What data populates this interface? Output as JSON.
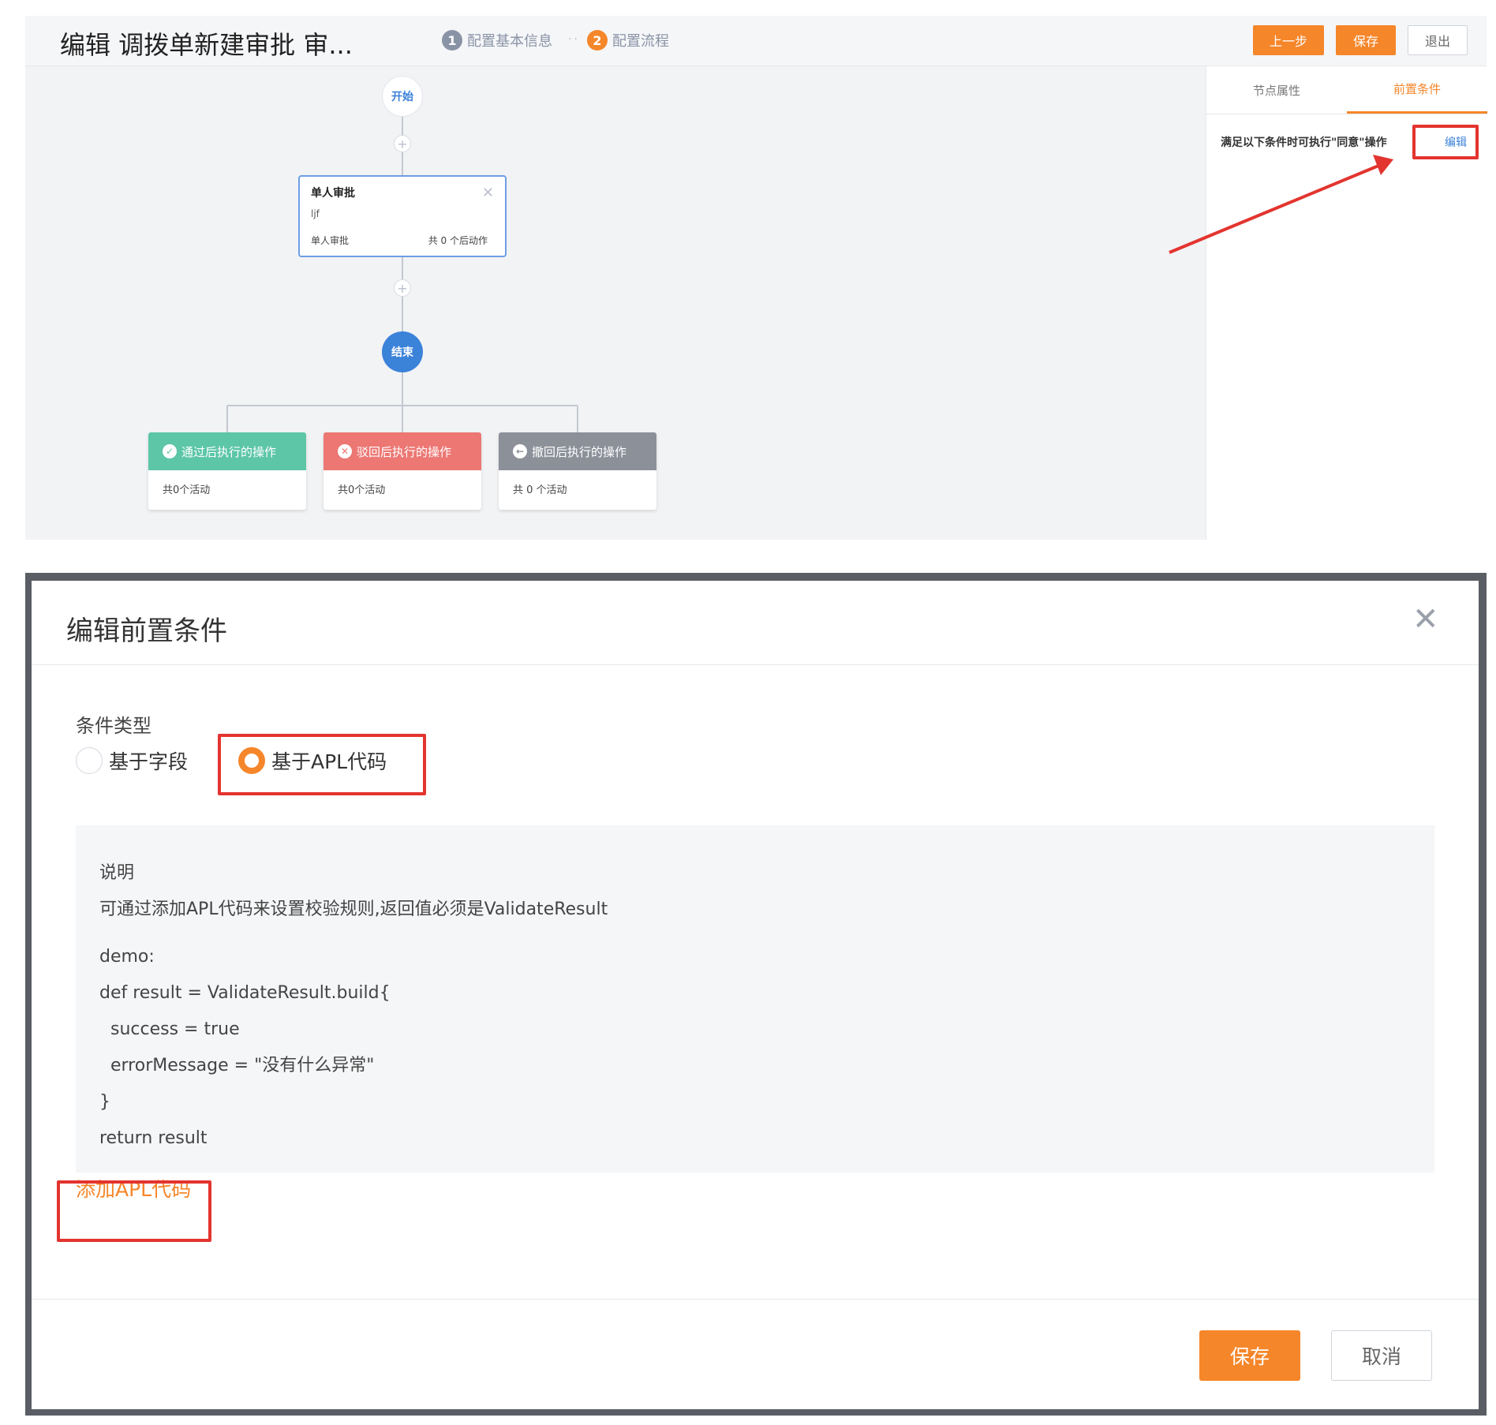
{
  "header": {
    "title": "编辑 调拨单新建审批 审...",
    "steps": [
      {
        "num": "1",
        "label": "配置基本信息"
      },
      {
        "num": "2",
        "label": "配置流程"
      }
    ],
    "step_separator": "··",
    "buttons": {
      "prev": "上一步",
      "save": "保存",
      "exit": "退出"
    }
  },
  "flow": {
    "start_label": "开始",
    "end_label": "结束",
    "plus": "+",
    "approval_node": {
      "title": "单人审批",
      "user": "ljf",
      "type": "单人审批",
      "after_actions": "共 0 个后动作",
      "close": "✕"
    },
    "result_cards": [
      {
        "icon": "✓",
        "title": "通过后执行的操作",
        "count": "共0个活动"
      },
      {
        "icon": "✕",
        "title": "驳回后执行的操作",
        "count": "共0个活动"
      },
      {
        "icon": "←",
        "title": "撤回后执行的操作",
        "count": "共 0 个活动"
      }
    ]
  },
  "right_panel": {
    "tabs": [
      "节点属性",
      "前置条件"
    ],
    "active_tab": "前置条件",
    "description": "满足以下条件时可执行\"同意\"操作",
    "edit_link": "编辑"
  },
  "modal": {
    "title": "编辑前置条件",
    "close": "✕",
    "condition_type_label": "条件类型",
    "radio_options": [
      {
        "label": "基于字段",
        "selected": false
      },
      {
        "label": "基于APL代码",
        "selected": true
      }
    ],
    "info": {
      "heading": "说明",
      "description": "可通过添加APL代码来设置校验规则,返回值必须是ValidateResult",
      "code_lines": [
        "demo:",
        "def result = ValidateResult.build{",
        "  success = true",
        "  errorMessage = \"没有什么异常\"",
        "}",
        "return result"
      ]
    },
    "add_apl_link": "添加APL代码",
    "save_button": "保存",
    "cancel_button": "取消"
  },
  "colors": {
    "accent_orange": "#f5862a",
    "primary_blue": "#3b82d9",
    "pass_green": "#5cc6a7",
    "reject_red": "#ec7773",
    "recall_gray": "#8c9099",
    "annotation_red": "#e3342f"
  }
}
